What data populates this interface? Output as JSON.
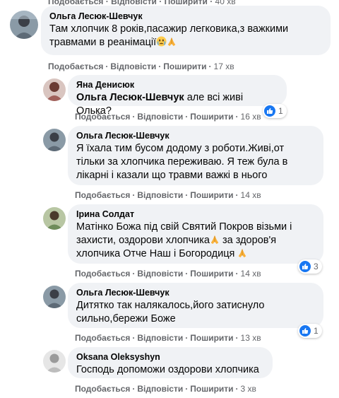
{
  "colors": {
    "bubble": "#f0f2f5",
    "meta": "#65676b",
    "like_blue": "#1877f2",
    "text": "#050505"
  },
  "actions_labels": {
    "like": "Подобається",
    "reply": "Відповісти",
    "share": "Поширити"
  },
  "top_row": {
    "time": "40 хв"
  },
  "comments": [
    {
      "author": "Ольга Лесюк-Шевчук",
      "text": "Там хлопчик 8 років,пасажир легковика,з важкими травмами в реанімації",
      "emoji": [
        "crying-face",
        "folded-hands"
      ],
      "time": "17 хв"
    },
    {
      "author": "Яна Денисюк",
      "mention": "Ольга Лесюк-Шевчук",
      "text": " але всі живі Олька?",
      "time": "16 хв",
      "reactions": {
        "icon": "like",
        "count": "1"
      }
    },
    {
      "author": "Ольга Лесюк-Шевчук",
      "text": "Я їхала тим бусом додому з роботи.Живі,от тільки за хлопчика переживаю. Я теж була в лікарні і казали що травми важкі в нього",
      "time": "14 хв"
    },
    {
      "author": "Ірина Солдат",
      "text_1": "Матінко Божа під свій Святий Покров візьми і захисти, оздорови хлопчика",
      "text_2": " за здоров'я хлопчика Отче Наш і Богородиця ",
      "time": "14 хв",
      "reactions": {
        "icon": "like",
        "count": "3"
      }
    },
    {
      "author": "Ольга Лесюк-Шевчук",
      "text": "Дитятко так налякалось,його затиснуло сильно,бережи Боже",
      "time": "13 хв",
      "reactions": {
        "icon": "like",
        "count": "1"
      }
    },
    {
      "author": "Oksana Oleksyshyn",
      "text": "Господь допоможи оздорови хлопчика",
      "time": "3 хв"
    }
  ]
}
